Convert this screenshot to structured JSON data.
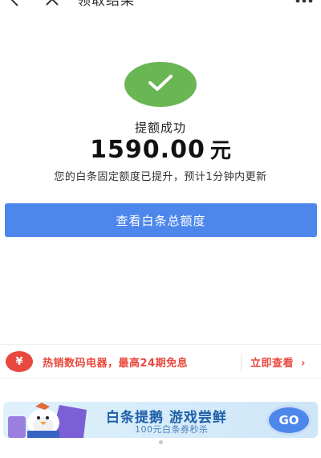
{
  "header": {
    "title": "领取结果",
    "back_icon": "back-arrow-icon",
    "close_icon": "close-icon",
    "more_icon": "more-icon"
  },
  "result": {
    "icon": "check-icon",
    "status": "提额成功",
    "amount": "1590.00",
    "unit": "元",
    "description": "您的白条固定额度已提升，预计1分钟内更新"
  },
  "primary_button": {
    "label": "查看白条总额度"
  },
  "promo": {
    "icon": "money-bag-icon",
    "icon_glyph": "¥",
    "text": "热销数码电器，最高24期免息",
    "link_label": "立即查看",
    "chevron": "›"
  },
  "banner": {
    "title": "白条提鹅 游戏尝鲜",
    "subtitle": "100元白条券秒杀",
    "go_label": "GO"
  },
  "colors": {
    "success": "#6ab554",
    "primary": "#4d87eb",
    "promo": "#e8483e"
  }
}
